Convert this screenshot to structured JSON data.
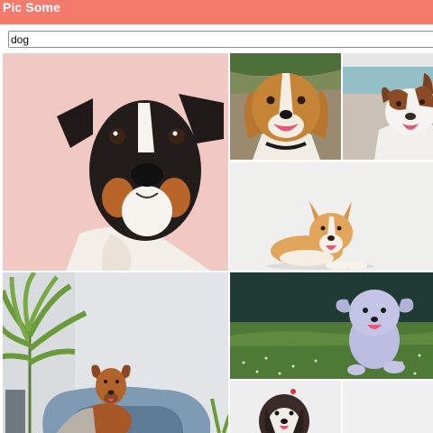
{
  "app": {
    "title": "Pic Some"
  },
  "search": {
    "value": "dog"
  },
  "photos": [
    {
      "id": "jack-russell-pink-backdrop",
      "alt": "dog"
    },
    {
      "id": "beagle-smiling",
      "alt": "dog"
    },
    {
      "id": "australian-shepherd-beach",
      "alt": "dog"
    },
    {
      "id": "corgi-white-backdrop",
      "alt": "dog"
    },
    {
      "id": "toller-in-dog-bed",
      "alt": "dog"
    },
    {
      "id": "fluffy-dog-running-grass",
      "alt": "dog"
    },
    {
      "id": "shih-tzu-with-bow",
      "alt": "dog"
    },
    {
      "id": "blank-white-photo",
      "alt": "dog"
    }
  ],
  "colors": {
    "header": "#f47a6b",
    "pink_backdrop": "#f2c8c2",
    "grass": "#4f7a35"
  }
}
